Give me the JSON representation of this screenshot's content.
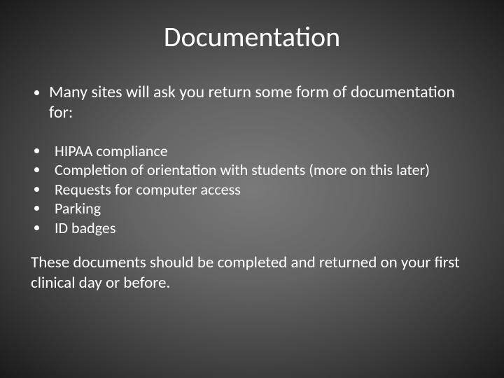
{
  "title": "Documentation",
  "intro": "Many sites will ask you return some form of documentation for:",
  "items": [
    "HIPAA compliance",
    "Completion of orientation with students (more on this later)",
    "Requests for computer access",
    "Parking",
    "ID badges"
  ],
  "closing": "These documents should be completed and returned on your first clinical day or before."
}
